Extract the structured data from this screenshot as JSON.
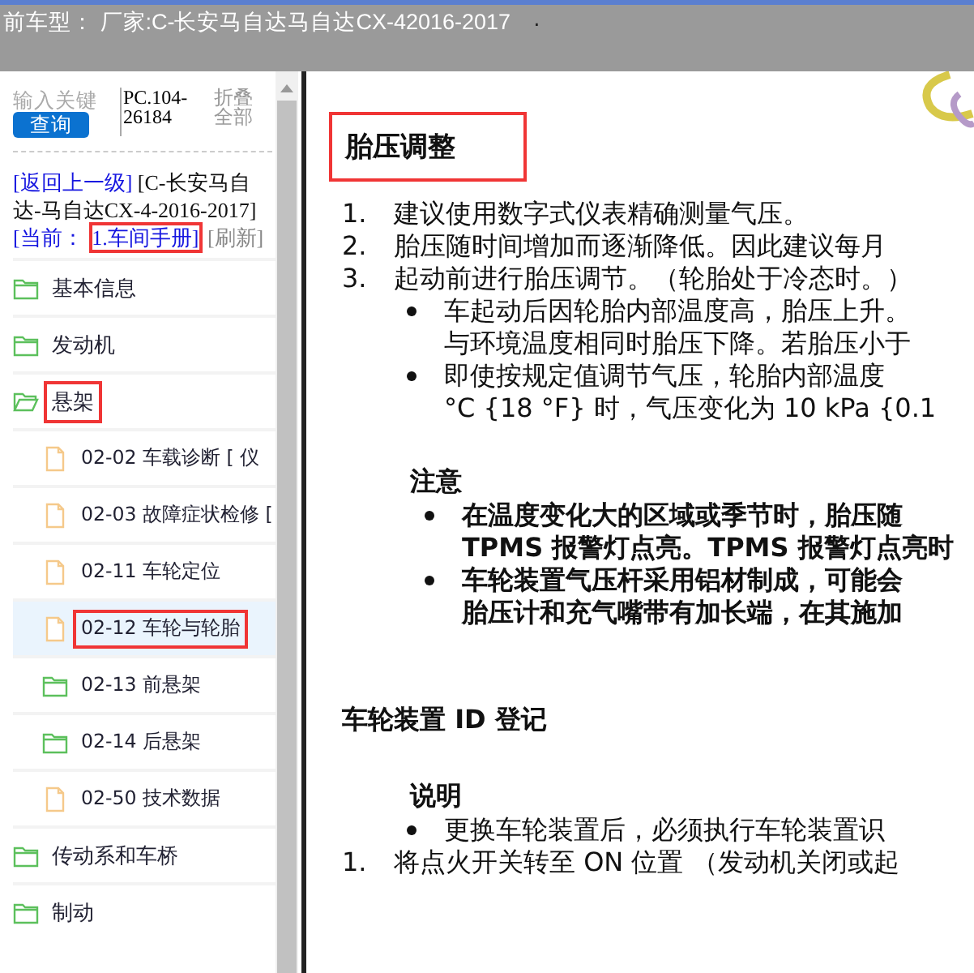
{
  "header": {
    "title": "前车型：  厂家:C-长安马自达马自达CX-42016-2017",
    "suffix": "."
  },
  "sidebar": {
    "search": {
      "placeholder": "输入关键",
      "button": "查询"
    },
    "code": "PC.104-26184",
    "collapse_all": "折叠全部",
    "breadcrumb": [
      {
        "kind": "link",
        "text": "[返回上一级]"
      },
      {
        "kind": "text",
        "text": "[C-长安马自达-马自达CX-4-2016-2017]"
      },
      {
        "kind": "link",
        "text": "[当前："
      },
      {
        "kind": "link",
        "text": "1.车间手册]",
        "highlighted": true
      },
      {
        "kind": "muted",
        "text": "[刷新]"
      }
    ],
    "tree": [
      {
        "label": "基本信息",
        "kind": "folder",
        "expanded": false,
        "selected": false
      },
      {
        "label": "发动机",
        "kind": "folder",
        "expanded": false,
        "selected": false
      },
      {
        "label": "悬架",
        "kind": "folder",
        "expanded": true,
        "selected": false,
        "highlighted": true,
        "children": [
          {
            "label": "02-02 车载诊断 [ 仪",
            "kind": "document",
            "selected": false
          },
          {
            "label": "02-03 故障症状检修 [",
            "kind": "document",
            "selected": false
          },
          {
            "label": "02-11 车轮定位",
            "kind": "document",
            "selected": false
          },
          {
            "label": "02-12 车轮与轮胎",
            "kind": "document",
            "selected": true,
            "highlighted": true
          },
          {
            "label": "02-13 前悬架",
            "kind": "folder",
            "expanded": false,
            "selected": false
          },
          {
            "label": "02-14 后悬架",
            "kind": "folder",
            "expanded": false,
            "selected": false
          },
          {
            "label": "02-50 技术数据",
            "kind": "document",
            "selected": false
          }
        ]
      },
      {
        "label": "传动系和车桥",
        "kind": "folder",
        "expanded": false,
        "selected": false
      },
      {
        "label": "制动",
        "kind": "folder",
        "expanded": false,
        "selected": false
      }
    ]
  },
  "content": [
    {
      "kind": "heading",
      "text": "胎压调整",
      "highlighted": true
    },
    {
      "kind": "step",
      "number": "1.",
      "text": "建议使用数字式仪表精确测量气压。"
    },
    {
      "kind": "step",
      "number": "2.",
      "text": "胎压随时间增加而逐渐降低。因此建议每月"
    },
    {
      "kind": "step",
      "number": "3.",
      "text": "起动前进行胎压调节。（轮胎处于冷态时。）"
    },
    {
      "kind": "bullet",
      "lines": [
        "车起动后因轮胎内部温度高，胎压上升。",
        "与环境温度相同时胎压下降。若胎压小于"
      ]
    },
    {
      "kind": "bullet",
      "lines": [
        "即使按规定值调节气压，轮胎内部温度",
        "°C {18 °F} 时，气压变化为 10 kPa {0.1"
      ]
    },
    {
      "kind": "note_title",
      "text": "注意"
    },
    {
      "kind": "note_bullet",
      "lines": [
        "在温度变化大的区域或季节时，胎压随",
        "TPMS 报警灯点亮。TPMS 报警灯点亮时"
      ]
    },
    {
      "kind": "note_bullet",
      "lines": [
        "车轮装置气压杆采用铝材制成，可能会",
        "胎压计和充气嘴带有加长端，在其施加"
      ]
    },
    {
      "kind": "subheading",
      "text": "车轮装置 ID 登记"
    },
    {
      "kind": "note_title",
      "text": "说明"
    },
    {
      "kind": "bullet",
      "lines": [
        "更换车轮装置后，必须执行车轮装置识"
      ]
    },
    {
      "kind": "step",
      "number": "1.",
      "text": "将点火开关转至 ON 位置 （发动机关闭或起"
    }
  ]
}
